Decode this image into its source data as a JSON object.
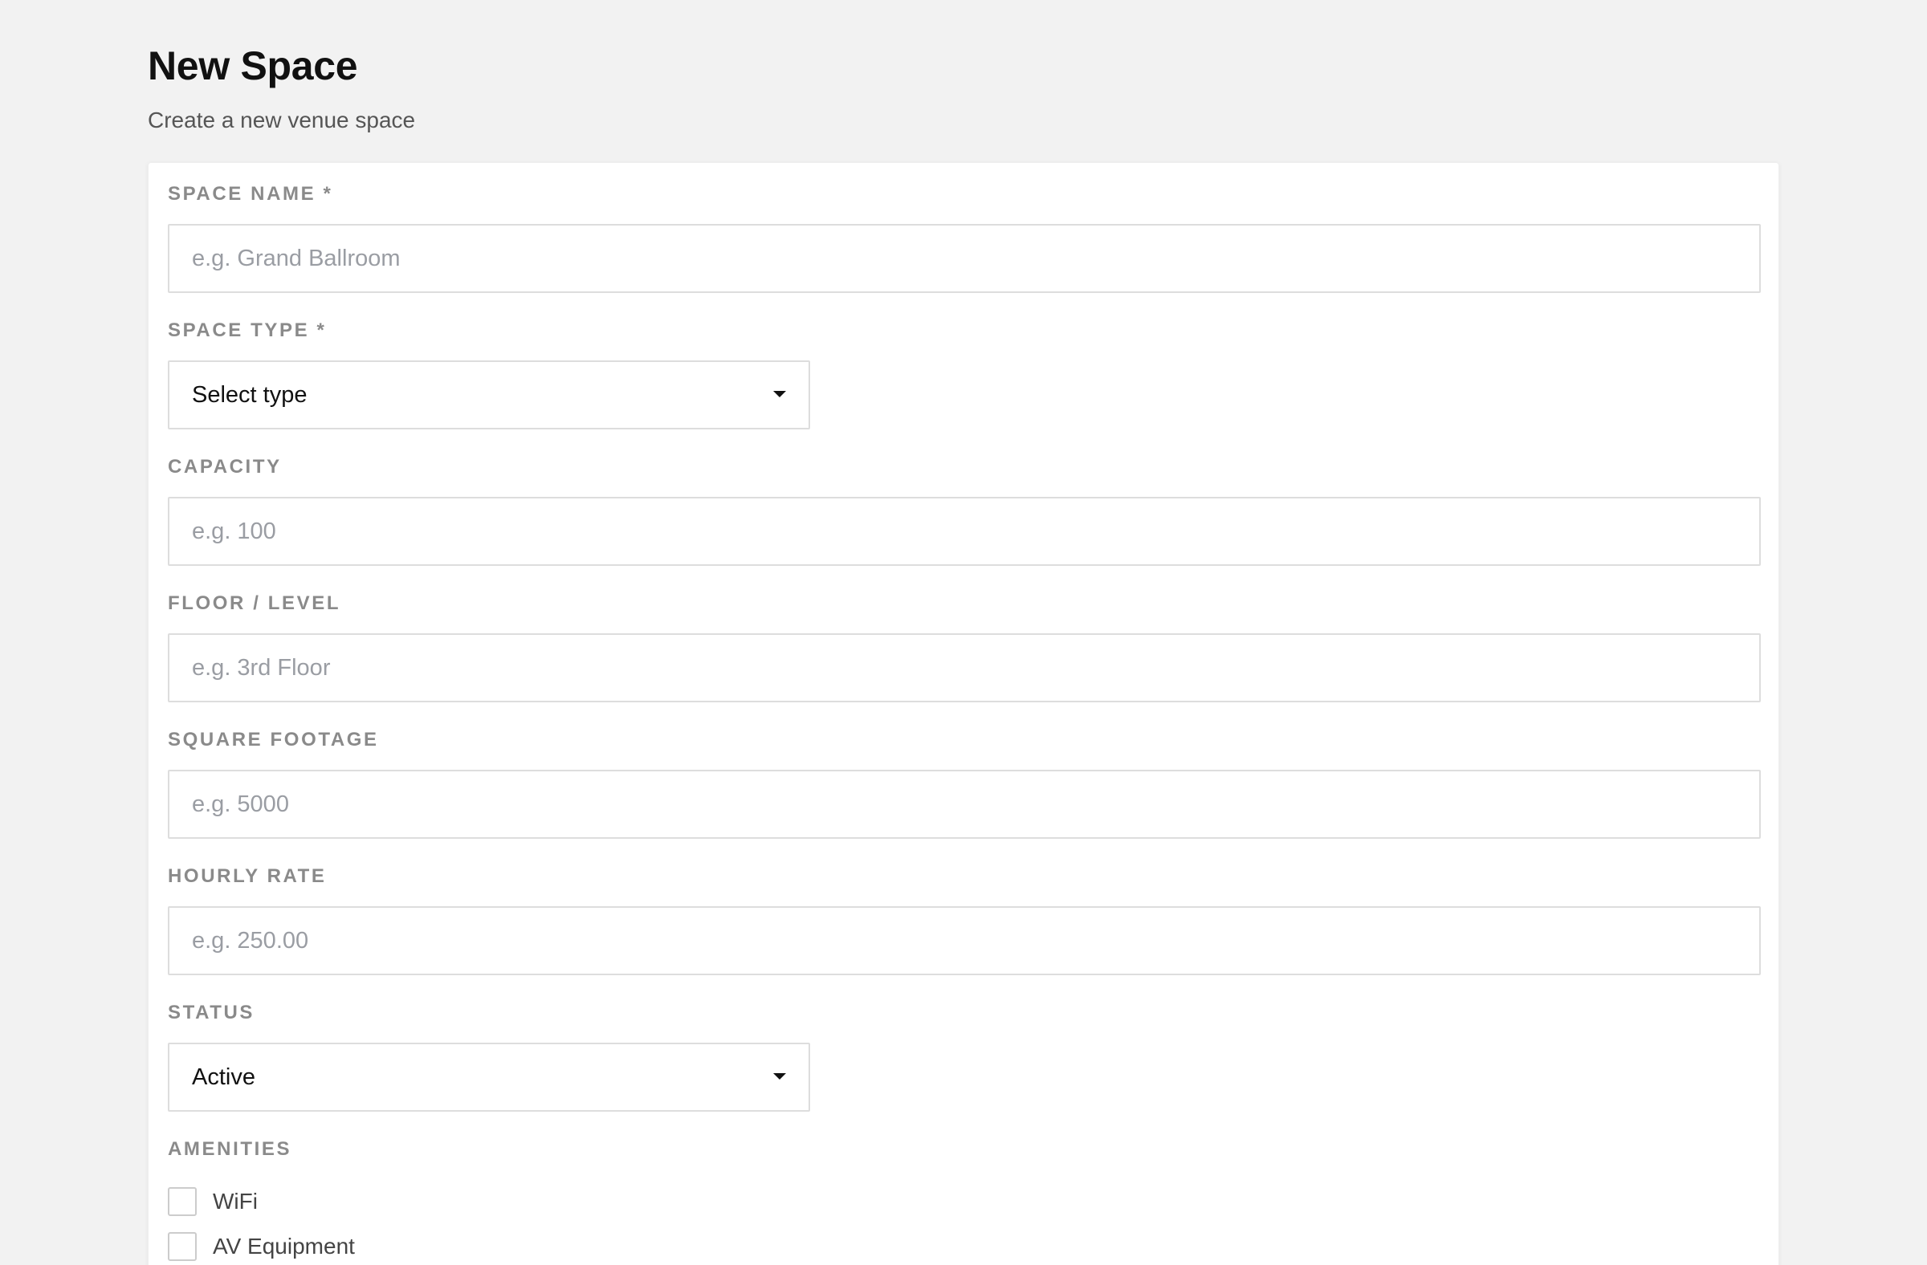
{
  "header": {
    "title": "New Space",
    "subtitle": "Create a new venue space"
  },
  "form": {
    "space_name": {
      "label": "SPACE NAME *",
      "placeholder": "e.g. Grand Ballroom",
      "value": ""
    },
    "space_type": {
      "label": "SPACE TYPE *",
      "value": "Select type",
      "icon": "chevron-down-icon"
    },
    "capacity": {
      "label": "CAPACITY",
      "placeholder": "e.g. 100",
      "value": ""
    },
    "floor_level": {
      "label": "FLOOR / LEVEL",
      "placeholder": "e.g. 3rd Floor",
      "value": ""
    },
    "square_footage": {
      "label": "SQUARE FOOTAGE",
      "placeholder": "e.g. 5000",
      "value": ""
    },
    "hourly_rate": {
      "label": "HOURLY RATE",
      "placeholder": "e.g. 250.00",
      "value": ""
    },
    "status": {
      "label": "STATUS",
      "value": "Active",
      "icon": "chevron-down-icon"
    },
    "amenities": {
      "label": "AMENITIES",
      "items": [
        {
          "label": "WiFi",
          "checked": false
        },
        {
          "label": "AV Equipment",
          "checked": false
        }
      ]
    }
  },
  "colors": {
    "page_background": "#f2f2f2",
    "card_background": "#ffffff",
    "label_text": "#8a8a8a",
    "placeholder_text": "#9a9da3",
    "border": "#dddddd"
  }
}
